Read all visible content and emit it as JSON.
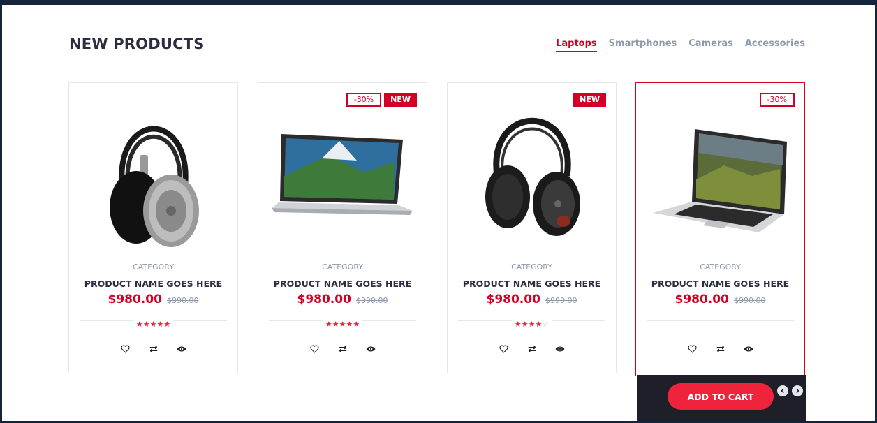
{
  "section": {
    "title": "NEW PRODUCTS"
  },
  "tabs": [
    {
      "label": "Laptops",
      "active": true
    },
    {
      "label": "Smartphones",
      "active": false
    },
    {
      "label": "Cameras",
      "active": false
    },
    {
      "label": "Accessories",
      "active": false
    }
  ],
  "products": [
    {
      "image": "headphones-silver",
      "category": "CATEGORY",
      "name": "PRODUCT NAME GOES HERE",
      "price": "$980.00",
      "old_price": "$990.00",
      "rating": 5,
      "badges": []
    },
    {
      "image": "laptop-macbook",
      "category": "CATEGORY",
      "name": "PRODUCT NAME GOES HERE",
      "price": "$980.00",
      "old_price": "$990.00",
      "rating": 5,
      "badges": [
        "-30%",
        "NEW"
      ]
    },
    {
      "image": "headphones-black",
      "category": "CATEGORY",
      "name": "PRODUCT NAME GOES HERE",
      "price": "$980.00",
      "old_price": "$990.00",
      "rating": 4,
      "badges": [
        "NEW"
      ]
    },
    {
      "image": "laptop-macbook-pro",
      "category": "CATEGORY",
      "name": "PRODUCT NAME GOES HERE",
      "price": "$980.00",
      "old_price": "$990.00",
      "rating": 0,
      "badges": [
        "-30%"
      ]
    }
  ],
  "cart": {
    "label": "ADD TO CART"
  },
  "icons": {
    "wishlist": "heart-icon",
    "compare": "exchange-icon",
    "quickview": "eye-icon",
    "prev": "chevron-left-icon",
    "next": "chevron-right-icon"
  },
  "colors": {
    "accent": "#d10024",
    "star": "#ef233c",
    "text": "#2b2d42",
    "muted": "#8d99ae",
    "dark": "#1e1f29",
    "frame": "#15243d"
  }
}
